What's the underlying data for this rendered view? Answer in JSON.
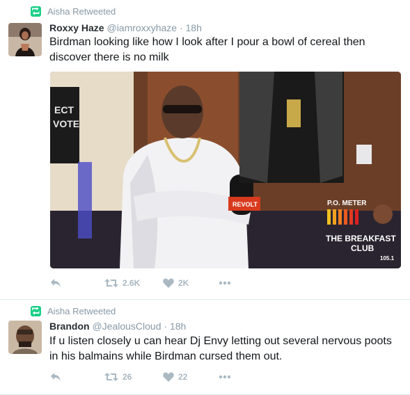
{
  "tweets": [
    {
      "retweeted_by": "Aisha Retweeted",
      "name": "Roxxy Haze",
      "handle": "@iamroxxyhaze",
      "time": "18h",
      "text_lines": [
        "Birdman looking like how I look after I pour a bowl of cereal then",
        "discover there is no milk"
      ],
      "retweets": "2.6K",
      "likes": "2K",
      "media": {
        "vote_sign": "ECT\nVOTE",
        "mic_flag": "REVOLT",
        "meter_label": "P.O. METER",
        "show_logo_line1": "THE BREAKFAST",
        "show_logo_line2": "CLUB",
        "station": "105.1"
      }
    },
    {
      "retweeted_by": "Aisha Retweeted",
      "name": "Brandon",
      "handle": "@JealousCloud",
      "time": "18h",
      "text_lines": [
        "If u listen closely u can hear Dj Envy letting out several nervous poots",
        "in his balmains while Birdman cursed them out."
      ],
      "retweets": "26",
      "likes": "22"
    }
  ],
  "colors": {
    "retweet_green": "#19cf86",
    "meta_gray": "#8899a6",
    "icon_gray": "#aab8c2"
  }
}
